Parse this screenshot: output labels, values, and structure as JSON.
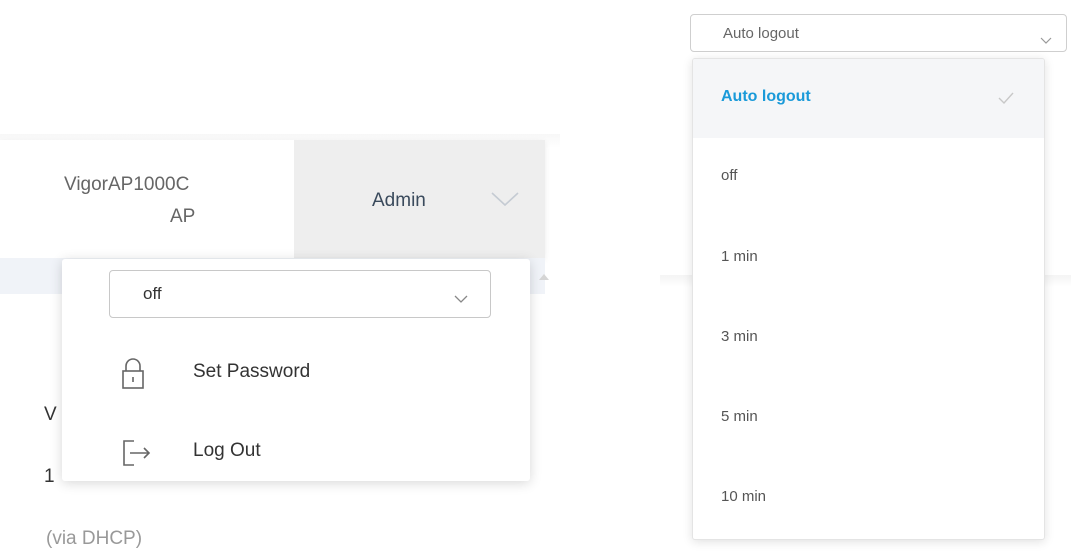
{
  "header": {
    "device_model": "VigorAP1000C",
    "device_type": "AP",
    "admin_label": "Admin"
  },
  "background_text": {
    "line1": "V",
    "line2": "1",
    "line3": "(via DHCP)"
  },
  "admin_menu": {
    "logout_select_value": "off",
    "items": [
      {
        "label": "Set Password",
        "icon": "lock-icon"
      },
      {
        "label": "Log Out",
        "icon": "logout-icon"
      }
    ]
  },
  "auto_logout_dropdown": {
    "selected_value": "Auto logout",
    "options": [
      {
        "label": "Auto logout",
        "selected": true
      },
      {
        "label": "off",
        "selected": false
      },
      {
        "label": "1 min",
        "selected": false
      },
      {
        "label": "3 min",
        "selected": false
      },
      {
        "label": "5 min",
        "selected": false
      },
      {
        "label": "10 min",
        "selected": false
      }
    ]
  },
  "colors": {
    "accent": "#1a9ad9",
    "admin_bg": "#eeeeee"
  }
}
